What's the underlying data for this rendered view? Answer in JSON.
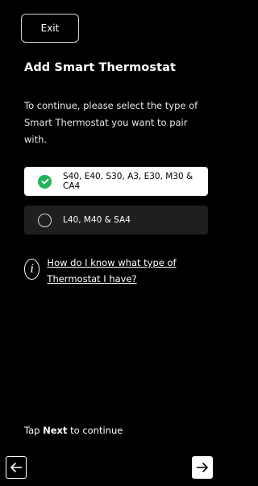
{
  "header": {
    "exit_label": "Exit"
  },
  "page": {
    "title": "Add Smart Thermostat",
    "intro": "To continue, please select the type of Smart Thermostat you want to pair with."
  },
  "options": [
    {
      "label": "S40, E40, S30, A3, E30, M30 & CA4",
      "selected": true
    },
    {
      "label": "L40, M40 & SA4",
      "selected": false
    }
  ],
  "help": {
    "link_text": "How do I know what type of Thermostat I have?"
  },
  "footer": {
    "tap_prefix": "Tap",
    "tap_bold": "Next",
    "tap_suffix": "to continue"
  },
  "icons": {
    "back": "arrow-left-icon",
    "next": "arrow-right-icon",
    "info": "info-icon",
    "check": "check-icon"
  },
  "colors": {
    "accent_green": "#22b45b",
    "background": "#000000"
  }
}
